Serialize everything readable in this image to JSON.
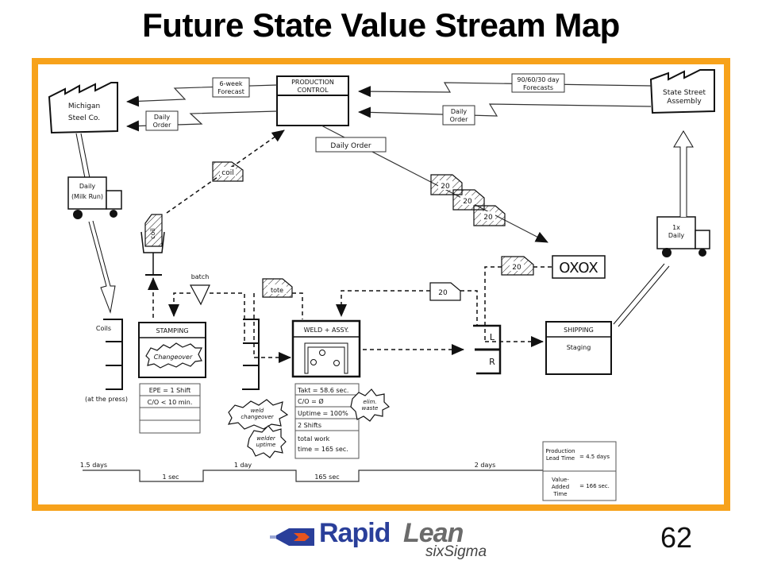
{
  "slide": {
    "title": "Future State Value Stream Map",
    "page_number": "62",
    "frame_color": "#f7a21b"
  },
  "logo": {
    "rapid": "Rapid",
    "lean": "Lean",
    "six_sigma": "sixSigma",
    "brand_blue": "#2a3f9a",
    "brand_gray": "#6b6b6b",
    "arrow_color": "#e8541e"
  },
  "map": {
    "supplier": {
      "line1": "Michigan",
      "line2": "Steel Co."
    },
    "customer": {
      "line1": "State Street",
      "line2": "Assembly"
    },
    "production_control": {
      "line1": "PRODUCTION",
      "line2": "CONTROL"
    },
    "info_flows": {
      "six_week_forecast": {
        "line1": "6-week",
        "line2": "Forecast"
      },
      "daily_order_supplier": {
        "line1": "Daily",
        "line2": "Order"
      },
      "forecasts_customer": {
        "line1": "90/60/30 day",
        "line2": "Forecasts"
      },
      "daily_order_customer": {
        "line1": "Daily",
        "line2": "Order"
      },
      "daily_order_pc": "Daily Order"
    },
    "inbound_truck": {
      "line1": "Daily",
      "line2": "(Milk Run)"
    },
    "outbound_truck": {
      "line1": "1x",
      "line2": "Daily"
    },
    "kanbans": {
      "coil_signal": "coil",
      "coil_post": "coil",
      "tote": "tote",
      "withdrawal": "20",
      "production_kanban": "20",
      "stack": [
        "20",
        "20",
        "20"
      ]
    },
    "load_leveling": "OXOX",
    "batch_label": "batch",
    "supermarket_coils": {
      "label": "Coils",
      "note": "(at the press)"
    },
    "supermarket_lr": {
      "top": "L",
      "bottom": "R"
    },
    "processes": [
      {
        "name": "STAMPING",
        "kaizen": "Changeover",
        "data": [
          "EPE = 1 Shift",
          "C/O < 10 min.",
          "",
          ""
        ]
      },
      {
        "name": "WELD + ASSY.",
        "data": [
          "Takt = 58.6 sec.",
          "C/O = Ø",
          "Uptime = 100%",
          "2 Shifts",
          "total work",
          "time = 165 sec."
        ]
      },
      {
        "name": "SHIPPING",
        "sub": "Staging"
      }
    ],
    "kaizen_bursts": [
      "weld changeover",
      "welder uptime",
      "elim. waste"
    ],
    "kaizen_burst_lines": {
      "weld": [
        "weld",
        "changeover"
      ],
      "welder": [
        "welder",
        "uptime"
      ],
      "elim": [
        "elim.",
        "waste"
      ]
    },
    "timeline": {
      "waits": [
        "1.5 days",
        "1 day",
        "2 days"
      ],
      "process_times": [
        "1 sec",
        "165 sec"
      ]
    },
    "summary": {
      "lead_time_label1": "Production",
      "lead_time_label2": "Lead Time",
      "lead_time_value": "= 4.5 days",
      "va_label1": "Value-",
      "va_label2": "Added",
      "va_label3": "Time",
      "va_value": "= 166 sec."
    }
  }
}
